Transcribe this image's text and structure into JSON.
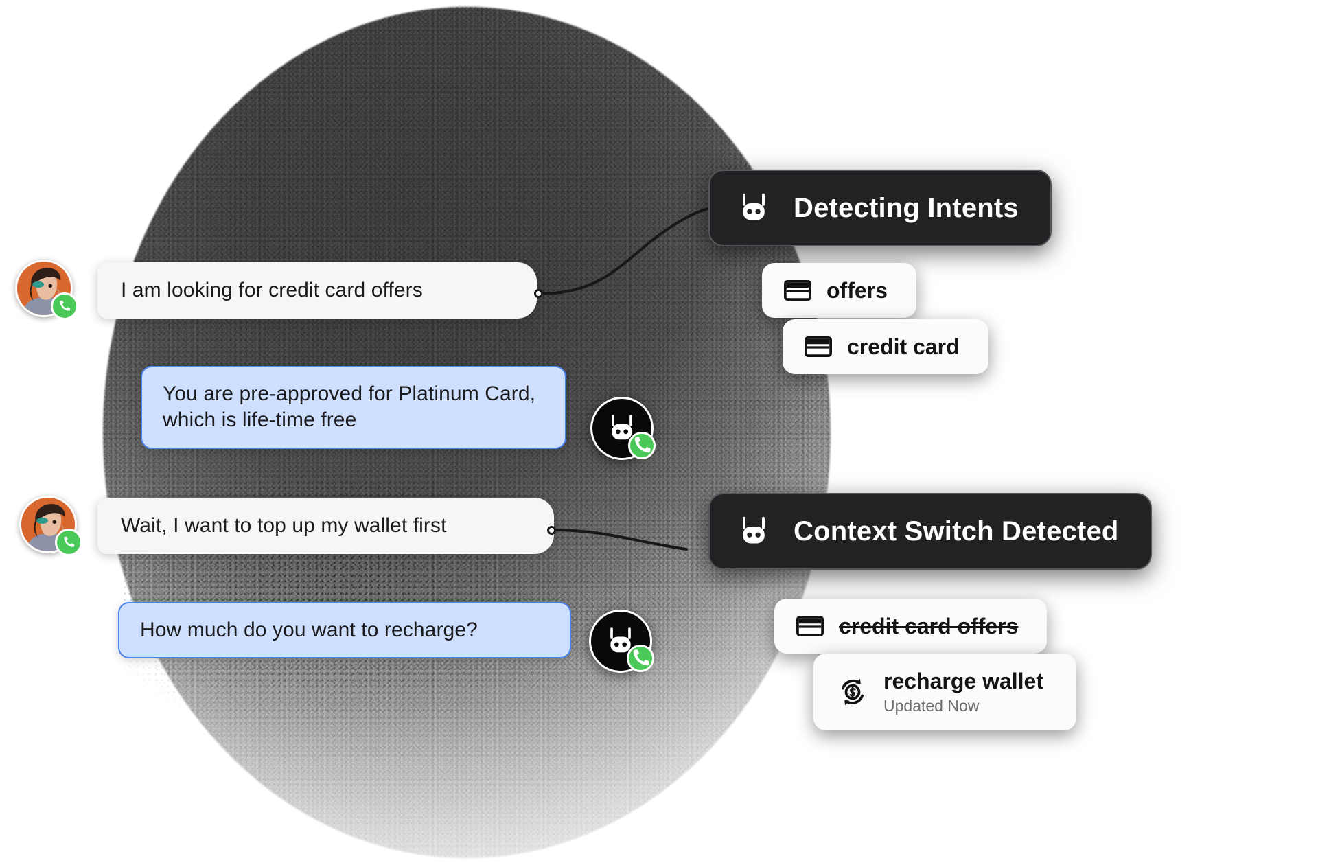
{
  "scene": {
    "title": "Conversational AI intent detection illustration"
  },
  "conversation": {
    "messages": [
      {
        "id": "msg-1",
        "sender": "user",
        "text": "I am looking for credit card offers",
        "avatar": "user-avatar",
        "badge": "phone-call-icon"
      },
      {
        "id": "msg-2",
        "sender": "bot",
        "text": "You are pre-approved for Platinum Card, which is life-time free",
        "avatar": "bot-avatar",
        "badge": "phone-call-icon"
      },
      {
        "id": "msg-3",
        "sender": "user",
        "text": "Wait, I want to top up my wallet first",
        "avatar": "user-avatar",
        "badge": "phone-call-icon"
      },
      {
        "id": "msg-4",
        "sender": "bot",
        "text": "How much do you want to recharge?",
        "avatar": "bot-avatar",
        "badge": "phone-call-icon"
      }
    ]
  },
  "panels": [
    {
      "id": "detecting-intents",
      "title": "Detecting Intents",
      "icon": "bot-icon",
      "chips": [
        {
          "id": "chip-offers",
          "label": "offers",
          "icon": "credit-card-icon",
          "struck": false,
          "sub": ""
        },
        {
          "id": "chip-credit-card",
          "label": "credit card",
          "icon": "credit-card-icon",
          "struck": false,
          "sub": ""
        }
      ]
    },
    {
      "id": "context-switch-detected",
      "title": "Context Switch Detected",
      "icon": "bot-icon",
      "chips": [
        {
          "id": "chip-credit-card-offers",
          "label": "credit card offers",
          "icon": "credit-card-icon",
          "struck": true,
          "sub": ""
        },
        {
          "id": "chip-recharge-wallet",
          "label": "recharge wallet",
          "icon": "recharge-money-icon",
          "struck": false,
          "sub": "Updated Now"
        }
      ]
    }
  ],
  "colors": {
    "bot_bubble_bg": "#cfe0ff",
    "bot_bubble_border": "#4b83e8",
    "user_bubble_bg": "#f6f6f6",
    "dark_card_bg": "#222224",
    "dark_card_border": "#55565a",
    "chip_bg": "#fbfbfb",
    "badge_green": "#4ac959",
    "avatar_orange": "#d9682f",
    "text_primary": "#141416",
    "text_muted": "#6d6e72"
  }
}
